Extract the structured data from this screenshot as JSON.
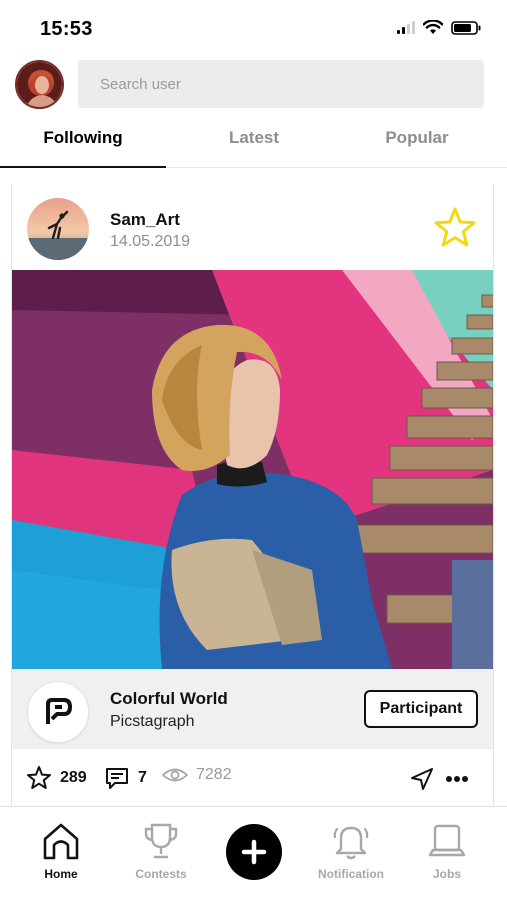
{
  "status_bar": {
    "time": "15:53"
  },
  "search": {
    "placeholder": "Search user"
  },
  "tabs": [
    {
      "label": "Following",
      "active": true
    },
    {
      "label": "Latest",
      "active": false
    },
    {
      "label": "Popular",
      "active": false
    }
  ],
  "post": {
    "username": "Sam_Art",
    "date": "14.05.2019",
    "favorite_icon": "star-outline-icon",
    "contest": {
      "title": "Colorful World",
      "subtitle": "Picstagraph",
      "button_label": "Participant"
    },
    "stats": {
      "likes": "289",
      "comments": "7",
      "views": "7282"
    }
  },
  "nav": {
    "items": [
      {
        "label": "Home",
        "icon": "home-icon",
        "active": true
      },
      {
        "label": "Contests",
        "icon": "trophy-icon",
        "active": false
      },
      {
        "label": "Notification",
        "icon": "bell-icon",
        "active": false
      },
      {
        "label": "Jobs",
        "icon": "laptop-icon",
        "active": false
      }
    ],
    "add_icon": "plus-icon"
  },
  "colors": {
    "star_accent": "#f5d80f",
    "active_text": "#111111",
    "inactive_text": "#8e8e8e"
  }
}
